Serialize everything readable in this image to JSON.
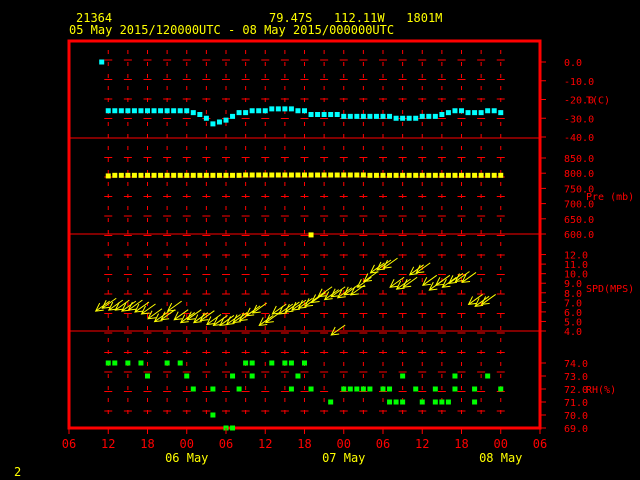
{
  "header": {
    "station": "21364",
    "location": "79.47S   112.11W   1801M",
    "time_range": "05 May 2015/120000UTC - 08 May 2015/000000UTC"
  },
  "footer": {
    "page_number": "2"
  },
  "colors": {
    "background": "#000000",
    "frame": "#ff0000",
    "grid": "#ff0000",
    "text": "#ffff00",
    "temperature": "#00ffff",
    "pressure": "#ffff00",
    "wind": "#ffff00",
    "rh": "#00ff00"
  },
  "chart_data": {
    "type": "scatter",
    "x_axis": {
      "tick_labels": [
        "06",
        "12",
        "18",
        "00",
        "06",
        "12",
        "18",
        "00",
        "06",
        "12",
        "18",
        "00",
        "06"
      ],
      "tick_hours": [
        -6,
        0,
        6,
        12,
        18,
        24,
        30,
        36,
        42,
        48,
        54,
        60,
        66
      ],
      "day_labels": [
        {
          "label": "06 May",
          "hour": 12
        },
        {
          "label": "07 May",
          "hour": 36
        },
        {
          "label": "08 May",
          "hour": 60
        }
      ],
      "range_hours": [
        -6,
        66
      ],
      "units": "hours since 05 May 2015 12 UTC",
      "vertical_tick_columns_hours": [
        0,
        3,
        6,
        9,
        12,
        15,
        18,
        21,
        24,
        27,
        30,
        33,
        36,
        39,
        42,
        45,
        48,
        51,
        54,
        57,
        60
      ]
    },
    "panels": [
      {
        "name": "temperature",
        "label": "T(C)",
        "ylim": [
          -40,
          0
        ],
        "ticks": [
          0,
          -10,
          -20,
          -30,
          -40
        ],
        "tick_labels": [
          "0.0",
          "-10.0",
          "-20.0",
          "-30.0",
          "-40.0"
        ],
        "points": [
          [
            -1,
            0
          ],
          [
            0,
            -26
          ],
          [
            1,
            -26
          ],
          [
            2,
            -26
          ],
          [
            3,
            -26
          ],
          [
            4,
            -26
          ],
          [
            5,
            -26
          ],
          [
            6,
            -26
          ],
          [
            7,
            -26
          ],
          [
            8,
            -26
          ],
          [
            9,
            -26
          ],
          [
            10,
            -26
          ],
          [
            11,
            -26
          ],
          [
            12,
            -26
          ],
          [
            13,
            -27
          ],
          [
            14,
            -28
          ],
          [
            15,
            -30
          ],
          [
            16,
            -33
          ],
          [
            17,
            -32
          ],
          [
            18,
            -31
          ],
          [
            19,
            -29
          ],
          [
            20,
            -27
          ],
          [
            21,
            -27
          ],
          [
            22,
            -26
          ],
          [
            23,
            -26
          ],
          [
            24,
            -26
          ],
          [
            25,
            -25
          ],
          [
            26,
            -25
          ],
          [
            27,
            -25
          ],
          [
            28,
            -25
          ],
          [
            29,
            -26
          ],
          [
            30,
            -26
          ],
          [
            31,
            -28
          ],
          [
            32,
            -28
          ],
          [
            33,
            -28
          ],
          [
            34,
            -28
          ],
          [
            35,
            -28
          ],
          [
            36,
            -29
          ],
          [
            37,
            -29
          ],
          [
            38,
            -29
          ],
          [
            39,
            -29
          ],
          [
            40,
            -29
          ],
          [
            41,
            -29
          ],
          [
            42,
            -29
          ],
          [
            43,
            -29
          ],
          [
            44,
            -30
          ],
          [
            45,
            -30
          ],
          [
            46,
            -30
          ],
          [
            47,
            -30
          ],
          [
            48,
            -29
          ],
          [
            49,
            -29
          ],
          [
            50,
            -29
          ],
          [
            51,
            -28
          ],
          [
            52,
            -27
          ],
          [
            53,
            -26
          ],
          [
            54,
            -26
          ],
          [
            55,
            -27
          ],
          [
            56,
            -27
          ],
          [
            57,
            -27
          ],
          [
            58,
            -26
          ],
          [
            59,
            -26
          ],
          [
            60,
            -27
          ]
        ]
      },
      {
        "name": "pressure",
        "label": "Pre (mb)",
        "ylim": [
          600,
          850
        ],
        "ticks": [
          850,
          800,
          750,
          700,
          650,
          600
        ],
        "tick_labels": [
          "850.0",
          "800.0",
          "750.0",
          "700.0",
          "650.0",
          "600.0"
        ],
        "points": [
          [
            0,
            791
          ],
          [
            1,
            793
          ],
          [
            2,
            793
          ],
          [
            3,
            793
          ],
          [
            4,
            793
          ],
          [
            5,
            793
          ],
          [
            6,
            793
          ],
          [
            7,
            793
          ],
          [
            8,
            793
          ],
          [
            9,
            793
          ],
          [
            10,
            793
          ],
          [
            11,
            793
          ],
          [
            12,
            793
          ],
          [
            13,
            793
          ],
          [
            14,
            793
          ],
          [
            15,
            793
          ],
          [
            16,
            793
          ],
          [
            17,
            793
          ],
          [
            18,
            793
          ],
          [
            19,
            793
          ],
          [
            20,
            793
          ],
          [
            21,
            794
          ],
          [
            22,
            794
          ],
          [
            23,
            794
          ],
          [
            24,
            794
          ],
          [
            25,
            794
          ],
          [
            26,
            794
          ],
          [
            27,
            794
          ],
          [
            28,
            794
          ],
          [
            29,
            794
          ],
          [
            30,
            794
          ],
          [
            31,
            794
          ],
          [
            32,
            794
          ],
          [
            33,
            794
          ],
          [
            34,
            794
          ],
          [
            35,
            794
          ],
          [
            36,
            794
          ],
          [
            37,
            794
          ],
          [
            38,
            794
          ],
          [
            39,
            794
          ],
          [
            40,
            793
          ],
          [
            41,
            793
          ],
          [
            42,
            793
          ],
          [
            43,
            793
          ],
          [
            44,
            793
          ],
          [
            45,
            793
          ],
          [
            46,
            793
          ],
          [
            47,
            793
          ],
          [
            48,
            793
          ],
          [
            49,
            793
          ],
          [
            50,
            793
          ],
          [
            51,
            793
          ],
          [
            52,
            793
          ],
          [
            53,
            793
          ],
          [
            54,
            793
          ],
          [
            55,
            793
          ],
          [
            56,
            793
          ],
          [
            57,
            793
          ],
          [
            58,
            793
          ],
          [
            59,
            793
          ],
          [
            60,
            793
          ],
          [
            31,
            597
          ]
        ]
      },
      {
        "name": "wind_speed",
        "label": "SPD(MPS)",
        "ylim": [
          4,
          13
        ],
        "ticks": [
          12,
          11,
          10,
          9,
          8,
          7,
          6,
          5,
          4
        ],
        "tick_labels": [
          "12.0",
          "11.0",
          "10.0",
          "9.0",
          "8.0",
          "7.0",
          "6.0",
          "5.0",
          "4.0"
        ],
        "arrow_direction_note": "arrows point toward lower-left",
        "points": [
          [
            -1,
            6.5
          ],
          [
            0,
            6.8
          ],
          [
            1,
            6.6
          ],
          [
            2,
            6.6
          ],
          [
            3,
            6.5
          ],
          [
            4,
            6.6
          ],
          [
            5,
            6.4
          ],
          [
            6,
            6.2
          ],
          [
            7,
            5.7
          ],
          [
            8,
            5.4
          ],
          [
            9,
            5.6
          ],
          [
            10,
            6.5
          ],
          [
            11,
            5.6
          ],
          [
            12,
            5.3
          ],
          [
            13,
            5.6
          ],
          [
            14,
            5.3
          ],
          [
            15,
            5.5
          ],
          [
            16,
            5.1
          ],
          [
            17,
            5.0
          ],
          [
            18,
            5.0
          ],
          [
            19,
            5.1
          ],
          [
            20,
            5.3
          ],
          [
            21,
            5.5
          ],
          [
            22,
            6.0
          ],
          [
            23,
            6.3
          ],
          [
            24,
            5.0
          ],
          [
            25,
            5.3
          ],
          [
            26,
            6.2
          ],
          [
            27,
            6.2
          ],
          [
            28,
            6.4
          ],
          [
            29,
            6.6
          ],
          [
            30,
            6.8
          ],
          [
            31,
            7.0
          ],
          [
            32,
            7.4
          ],
          [
            33,
            8.0
          ],
          [
            34,
            7.7
          ],
          [
            35,
            8.0
          ],
          [
            36,
            7.9
          ],
          [
            37,
            8.2
          ],
          [
            38,
            8.2
          ],
          [
            39,
            9.0
          ],
          [
            40,
            9.6
          ],
          [
            41,
            10.5
          ],
          [
            42,
            10.8
          ],
          [
            43,
            11.0
          ],
          [
            44,
            9.0
          ],
          [
            45,
            8.8
          ],
          [
            46,
            9.0
          ],
          [
            47,
            10.3
          ],
          [
            48,
            10.5
          ],
          [
            49,
            9.2
          ],
          [
            50,
            8.7
          ],
          [
            51,
            9.2
          ],
          [
            52,
            9.0
          ],
          [
            53,
            9.4
          ],
          [
            54,
            9.6
          ],
          [
            55,
            9.5
          ],
          [
            56,
            7.2
          ],
          [
            57,
            7.0
          ],
          [
            58,
            7.2
          ],
          [
            35,
            4.0
          ]
        ]
      },
      {
        "name": "relative_humidity",
        "label": "RH(%)",
        "ylim": [
          69,
          75
        ],
        "ticks": [
          74,
          73,
          72,
          71,
          70,
          69
        ],
        "tick_labels": [
          "74.0",
          "73.0",
          "72.0",
          "71.0",
          "70.0",
          "69.0"
        ],
        "points": [
          [
            0,
            74
          ],
          [
            1,
            74
          ],
          [
            3,
            74
          ],
          [
            5,
            74
          ],
          [
            9,
            74
          ],
          [
            11,
            74
          ],
          [
            21,
            74
          ],
          [
            22,
            74
          ],
          [
            25,
            74
          ],
          [
            27,
            74
          ],
          [
            28,
            74
          ],
          [
            30,
            74
          ],
          [
            6,
            73
          ],
          [
            12,
            73
          ],
          [
            19,
            73
          ],
          [
            22,
            73
          ],
          [
            29,
            73
          ],
          [
            45,
            73
          ],
          [
            53,
            73
          ],
          [
            58,
            73
          ],
          [
            60,
            72
          ],
          [
            13,
            72
          ],
          [
            16,
            72
          ],
          [
            20,
            72
          ],
          [
            28,
            72
          ],
          [
            31,
            72
          ],
          [
            36,
            72
          ],
          [
            37,
            72
          ],
          [
            38,
            72
          ],
          [
            39,
            72
          ],
          [
            40,
            72
          ],
          [
            42,
            72
          ],
          [
            43,
            72
          ],
          [
            47,
            72
          ],
          [
            50,
            72
          ],
          [
            53,
            72
          ],
          [
            56,
            72
          ],
          [
            56,
            71
          ],
          [
            34,
            71
          ],
          [
            43,
            71
          ],
          [
            44,
            71
          ],
          [
            45,
            71
          ],
          [
            48,
            71
          ],
          [
            50,
            71
          ],
          [
            51,
            71
          ],
          [
            52,
            71
          ],
          [
            16,
            70
          ],
          [
            18,
            69
          ],
          [
            19,
            69
          ]
        ]
      }
    ]
  }
}
